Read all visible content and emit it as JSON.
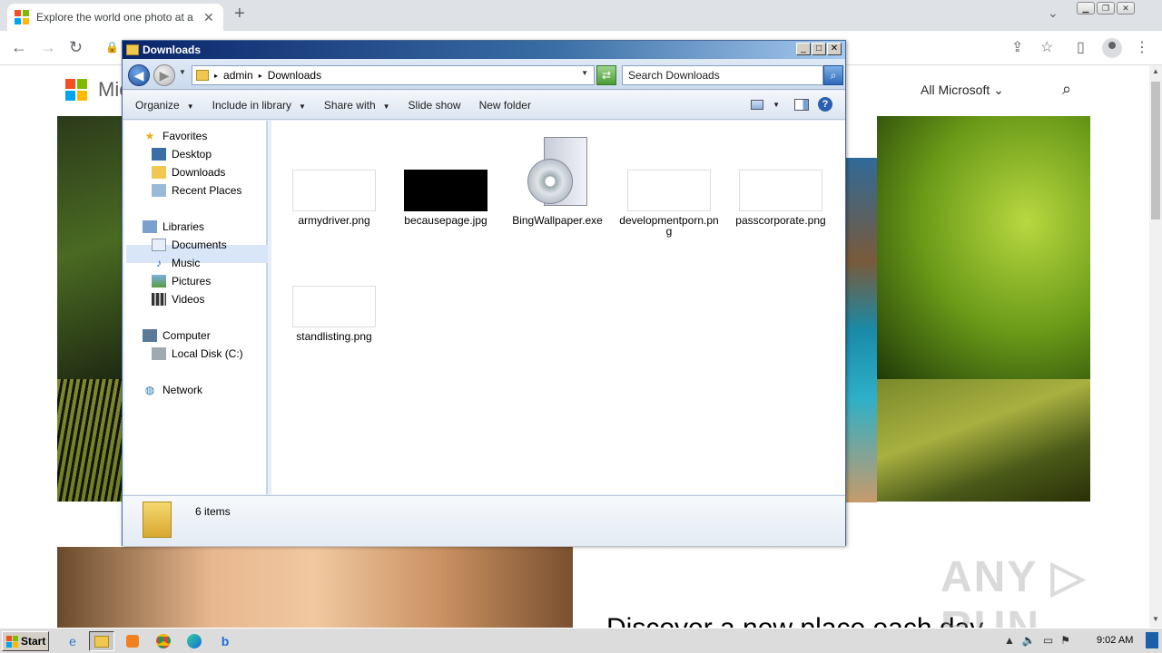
{
  "browser": {
    "tab_title": "Explore the world one photo at a time",
    "new_tab": "+",
    "close": "✕",
    "tabs_dropdown": "⌄",
    "window_buttons": [
      "▁",
      "❐",
      "✕"
    ]
  },
  "toolbar": {
    "back": "←",
    "forward": "→",
    "reload": "↻",
    "lock": "🔒",
    "share": "⇪",
    "star": "☆",
    "sidepanel": "▯"
  },
  "page": {
    "brand": "Mic",
    "all_microsoft": "All Microsoft ⌄",
    "search_icon": "⌕",
    "discover": "Discover a new place each day",
    "watermark": "ANY ▷ RUN"
  },
  "explorer": {
    "title": "Downloads",
    "controls": [
      "_",
      "□",
      "✕"
    ],
    "breadcrumb": [
      "admin",
      "Downloads"
    ],
    "search_placeholder": "Search Downloads",
    "commands": [
      "Organize",
      "Include in library",
      "Share with",
      "Slide show",
      "New folder"
    ],
    "help": "?",
    "nav": {
      "favorites": "Favorites",
      "desktop": "Desktop",
      "downloads": "Downloads",
      "recent": "Recent Places",
      "libraries": "Libraries",
      "documents": "Documents",
      "music": "Music",
      "pictures": "Pictures",
      "videos": "Videos",
      "computer": "Computer",
      "local_disk": "Local Disk (C:)",
      "network": "Network"
    },
    "files": [
      {
        "name": "armydriver.png"
      },
      {
        "name": "becausepage.jpg"
      },
      {
        "name": "BingWallpaper.exe"
      },
      {
        "name": "developmentporn.png"
      },
      {
        "name": "passcorporate.png"
      },
      {
        "name": "standlisting.png"
      }
    ],
    "status": "6 items"
  },
  "taskbar": {
    "start": "Start",
    "clock": "9:02 AM"
  },
  "colors": {
    "ms_red": "#f25022",
    "ms_green": "#7fba00",
    "ms_blue": "#00a4ef",
    "ms_yellow": "#ffb900",
    "titlebar": "#0a246a"
  }
}
